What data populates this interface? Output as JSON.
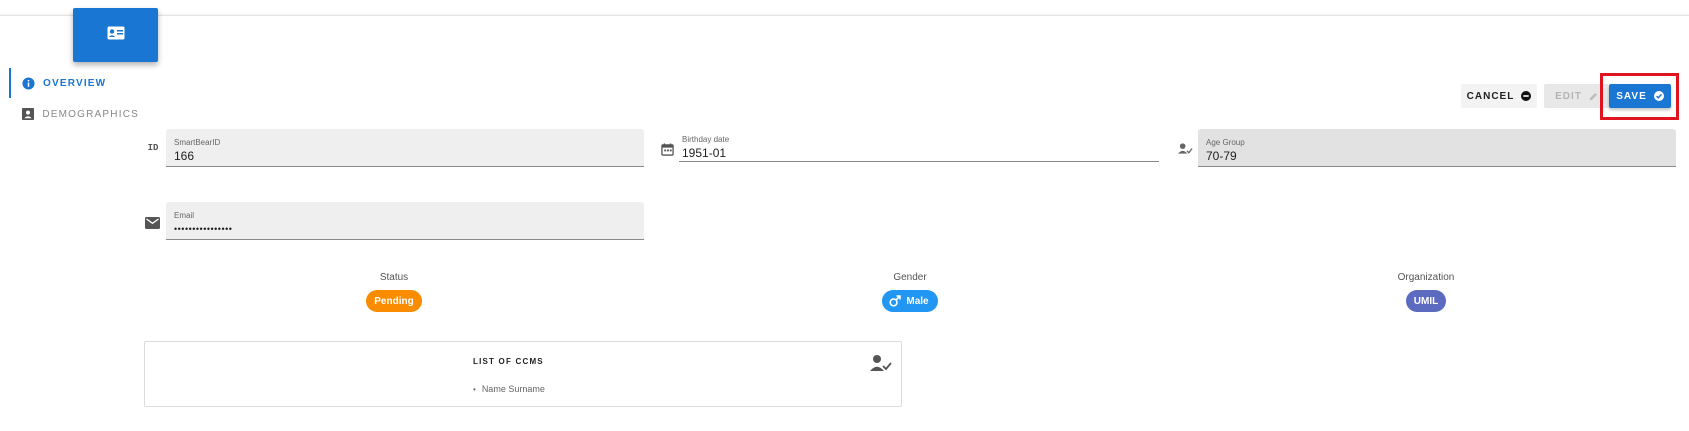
{
  "header": {
    "icon": "id-card-icon",
    "color": "#1976d2"
  },
  "nav": {
    "items": [
      {
        "label": "OVERVIEW",
        "icon": "info-icon",
        "active": true
      },
      {
        "label": "DEMOGRAPHICS",
        "icon": "person-card-icon",
        "active": false
      }
    ]
  },
  "toolbar": {
    "cancel_label": "CANCEL",
    "cancel_icon": "minus-circle-icon",
    "edit_label": "EDIT",
    "edit_icon": "pencil-icon",
    "save_label": "SAVE",
    "save_icon": "check-circle-icon"
  },
  "fields": {
    "id": {
      "prefix": "ID",
      "label": "SmartBearID",
      "value": "166"
    },
    "birthday": {
      "icon": "calendar-icon",
      "label": "Birthday date",
      "value": "1951-01"
    },
    "age_group": {
      "icon": "person-check-icon",
      "label": "Age Group",
      "value": "70-79"
    },
    "email": {
      "icon": "envelope-icon",
      "label": "Email",
      "value": "••••••••••••••••"
    }
  },
  "chips": {
    "status": {
      "title": "Status",
      "value": "Pending",
      "color": "#fb8c00"
    },
    "gender": {
      "title": "Gender",
      "value": "Male",
      "icon": "male-icon",
      "color": "#2196f3"
    },
    "organization": {
      "title": "Organization",
      "value": "UMIL",
      "color": "#5c6bc0"
    }
  },
  "ccms": {
    "title": "LIST OF CCMS",
    "icon": "person-check-icon",
    "items": [
      "Name Surname"
    ]
  },
  "colors": {
    "accent": "#1976d2",
    "highlight": "#e0141e"
  }
}
